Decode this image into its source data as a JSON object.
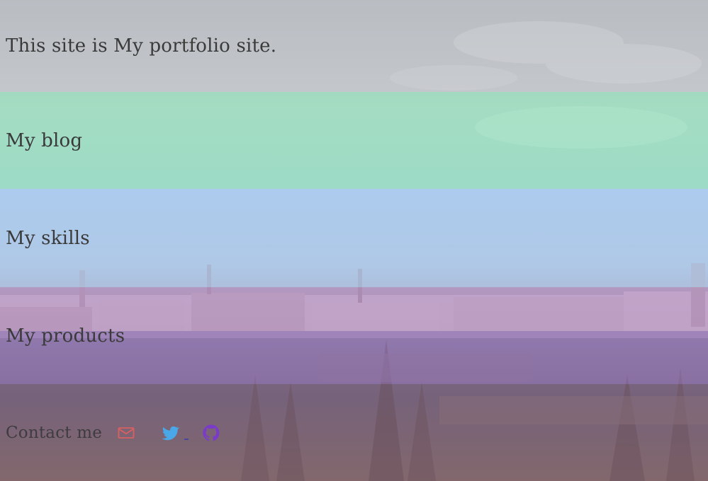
{
  "sections": {
    "intro": "This site is My portfolio site.",
    "blog": "My blog",
    "skills": "My skills",
    "products": "My products",
    "contact": "Contact me"
  },
  "icons": {
    "mail": "mail-icon",
    "twitter": "twitter-icon",
    "github": "github-icon"
  },
  "colors": {
    "intro_overlay": "#b4b8be",
    "blog_overlay": "#78daa9",
    "skills_overlay": "#96bef0",
    "products_overlay": "#9669be",
    "contact_overlay": "#6e4664",
    "mail_icon": "#d86060",
    "twitter_icon": "#4aa8e8",
    "github_icon": "#7a3cc8"
  }
}
